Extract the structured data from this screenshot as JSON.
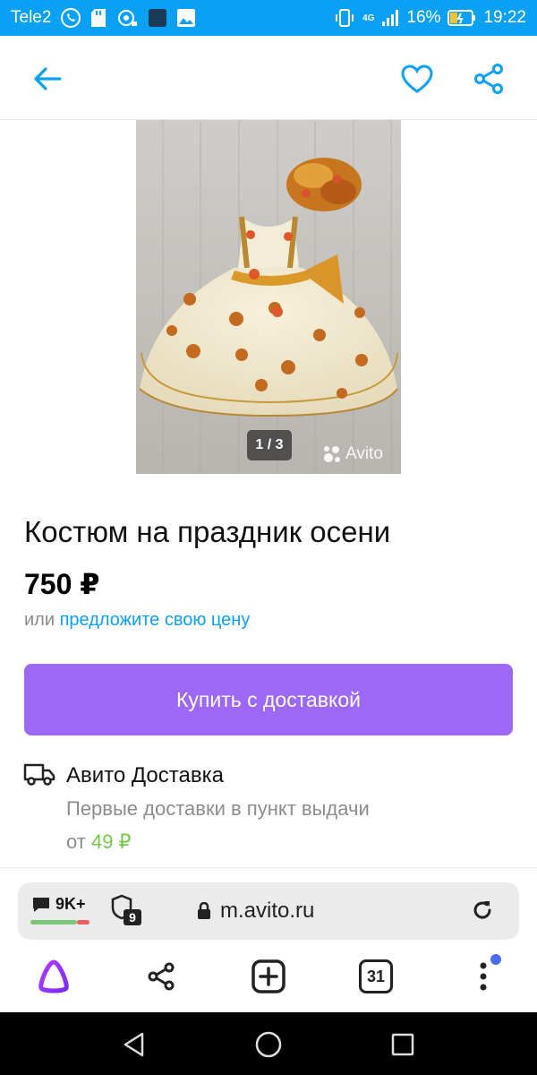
{
  "status_bar": {
    "carrier": "Tele2",
    "network": "4G",
    "battery": "16%",
    "time": "19:22"
  },
  "header": {
    "back_icon": "arrow-left-icon",
    "favorite_icon": "heart-icon",
    "share_icon": "share-icon"
  },
  "gallery": {
    "counter": "1 / 3",
    "watermark": "Avito"
  },
  "listing": {
    "title": "Костюм на праздник осени",
    "price": "750 ₽",
    "offer_or": "или",
    "offer_link": "предложите свою цену",
    "buy_button": "Купить с доставкой"
  },
  "delivery": {
    "title": "Авито Доставка",
    "subtitle": "Первые доставки в пункт выдачи",
    "from": "от",
    "price": "49 ₽"
  },
  "browser": {
    "comments_count": "9K+",
    "shield_count": "9",
    "url": "m.avito.ru",
    "tabs_count": "31"
  },
  "colors": {
    "accent_blue": "#0aa0f3",
    "buy_purple": "#9d68f5",
    "price_green": "#76c64a"
  }
}
